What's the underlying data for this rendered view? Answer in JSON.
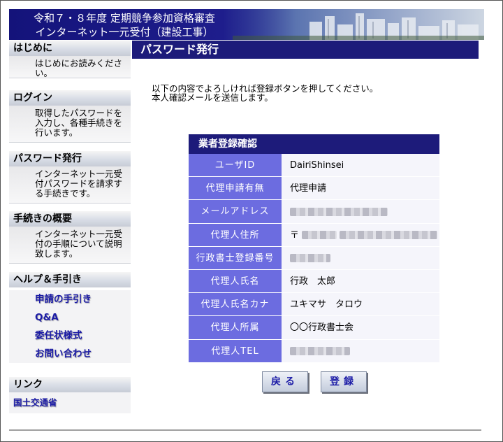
{
  "header": {
    "title_line1": "令和７・８年度 定期競争参加資格審査",
    "title_line2": "インターネット一元受付（建設工事）"
  },
  "sidebar": {
    "sections": [
      {
        "heading": "はじめに",
        "desc": "はじめにお読みください。"
      },
      {
        "heading": "ログイン",
        "desc": "取得したパスワードを入力し、各種手続きを行います。"
      },
      {
        "heading": "パスワード発行",
        "desc": "インターネット一元受付パスワードを請求する手続きです。"
      },
      {
        "heading": "手続きの概要",
        "desc": "インターネット一元受付の手順について説明致します。"
      }
    ],
    "help": {
      "heading": "ヘルプ＆手引き",
      "links": [
        "申請の手引き",
        "Q&A",
        "委任状様式",
        "お問い合わせ"
      ]
    },
    "links_section": {
      "heading": "リンク",
      "links": [
        "国土交通省"
      ]
    }
  },
  "main": {
    "title": "パスワード発行",
    "intro_line1": "以下の内容でよろしければ登録ボタンを押してください。",
    "intro_line2": "本人確認メールを送信します。",
    "table_title": "業者登録確認",
    "rows": [
      {
        "label": "ユーザID",
        "value": "DairiShinsei"
      },
      {
        "label": "代理申請有無",
        "value": "代理申請"
      },
      {
        "label": "メールアドレス",
        "value": ""
      },
      {
        "label": "代理人住所",
        "value": "〒"
      },
      {
        "label": "行政書士登録番号",
        "value": ""
      },
      {
        "label": "代理人氏名",
        "value": "行政　太郎"
      },
      {
        "label": "代理人氏名カナ",
        "value": "ユキマサ　タロウ"
      },
      {
        "label": "代理人所属",
        "value": "〇〇行政書士会"
      },
      {
        "label": "代理人TEL",
        "value": ""
      }
    ],
    "buttons": {
      "back": "戻る",
      "register": "登録"
    }
  },
  "colors": {
    "navy": "#1d1b7a",
    "label_bg": "#6c6ce0",
    "link": "#1b1ba6"
  }
}
